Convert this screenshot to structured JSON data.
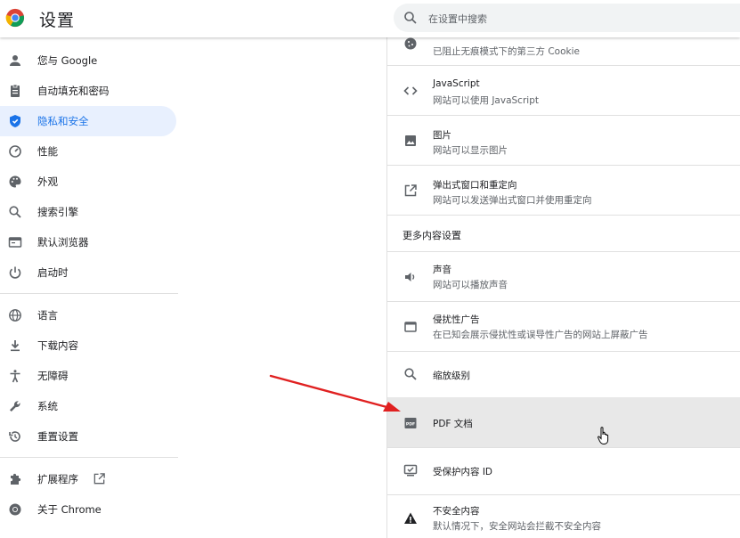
{
  "app": {
    "title": "设置",
    "search_placeholder": "在设置中搜索"
  },
  "sidebar": {
    "items": [
      {
        "label": "您与 Google",
        "icon": "person-icon"
      },
      {
        "label": "自动填充和密码",
        "icon": "clipboard-icon"
      },
      {
        "label": "隐私和安全",
        "icon": "shield-icon",
        "active": true
      },
      {
        "label": "性能",
        "icon": "speedometer-icon"
      },
      {
        "label": "外观",
        "icon": "palette-icon"
      },
      {
        "label": "搜索引擎",
        "icon": "search-icon"
      },
      {
        "label": "默认浏览器",
        "icon": "browser-icon"
      },
      {
        "label": "启动时",
        "icon": "power-icon"
      },
      {
        "label": "语言",
        "icon": "globe-icon"
      },
      {
        "label": "下载内容",
        "icon": "download-icon"
      },
      {
        "label": "无障碍",
        "icon": "accessibility-icon"
      },
      {
        "label": "系统",
        "icon": "wrench-icon"
      },
      {
        "label": "重置设置",
        "icon": "reset-icon"
      },
      {
        "label": "扩展程序",
        "icon": "puzzle-icon"
      },
      {
        "label": "关于 Chrome",
        "icon": "chrome-icon"
      }
    ]
  },
  "content": {
    "cookie": {
      "subtitle": "已阻止无痕模式下的第三方 Cookie"
    },
    "javascript": {
      "title": "JavaScript",
      "subtitle": "网站可以使用 JavaScript"
    },
    "images": {
      "title": "图片",
      "subtitle": "网站可以显示图片"
    },
    "popups": {
      "title": "弹出式窗口和重定向",
      "subtitle": "网站可以发送弹出式窗口并使用重定向"
    },
    "more_header": "更多内容设置",
    "sound": {
      "title": "声音",
      "subtitle": "网站可以播放声音"
    },
    "ads": {
      "title": "侵扰性广告",
      "subtitle": "在已知会展示侵扰性或误导性广告的网站上屏蔽广告"
    },
    "zoom": {
      "title": "缩放级别"
    },
    "pdf": {
      "title": "PDF 文档"
    },
    "protected": {
      "title": "受保护内容 ID"
    },
    "insecure": {
      "title": "不安全内容",
      "subtitle": "默认情况下，安全网站会拦截不安全内容"
    }
  },
  "colors": {
    "accent": "#1a73e8",
    "active_bg": "#e8f0fe",
    "hover_row": "#e8e8e8",
    "arrow": "#e02020"
  }
}
